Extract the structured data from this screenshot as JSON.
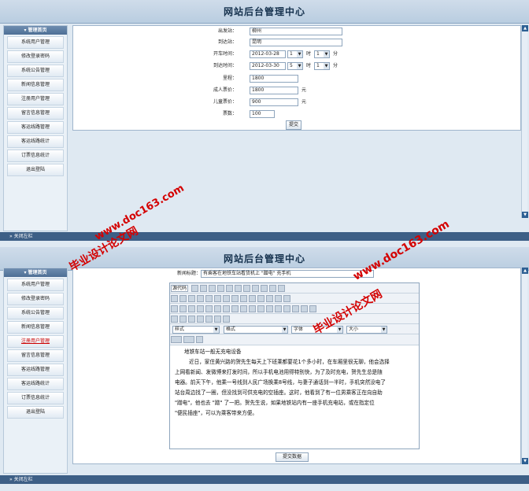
{
  "app_title": "网站后台管理中心",
  "sidebar": {
    "header": "管理首页",
    "items": [
      "系统用户管理",
      "修改登录密码",
      "系统公告管理",
      "新闻信息管理",
      "注册用户管理",
      "留言信息管理",
      "客运线路管理",
      "客运线路统计",
      "订票信息统计",
      "退出登陆"
    ],
    "close_label": "关闭左栏"
  },
  "form1": {
    "depart_label": "出发站：",
    "depart_value": "柳州",
    "arrive_label": "到达站：",
    "arrive_value": "昆明",
    "depart_time_label": "开车时间：",
    "depart_date": "2012-03-28",
    "depart_hour": "1",
    "depart_min": "1",
    "arrive_time_label": "到达时间：",
    "arrive_date": "2012-03-30",
    "arrive_hour": "5",
    "arrive_min": "1",
    "hour_unit": "时",
    "min_unit": "分",
    "distance_label": "里程：",
    "distance_value": "1800",
    "adult_label": "成人票价：",
    "adult_value": "1800",
    "child_label": "儿童票价：",
    "child_value": "900",
    "yuan": "元",
    "tickets_label": "票数：",
    "tickets_value": "100",
    "submit": "提交"
  },
  "form2": {
    "title_label": "新闻标题：",
    "title_value": "有乘客在地铁车站看货机上 \"蹭电\" 充手机",
    "toolbar": {
      "source": "源代码",
      "style": "样式",
      "format": "格式",
      "font": "字体",
      "size": "大小"
    },
    "content": [
      "地铁车站一般无充电设备",
      "近日，家住黄兴路的贺先生每天上下班乘都要花1个多小时，在车厢里很无聊，他会选择",
      "上网看新闻、发微博来打发时间，所以手机电池用得特别快，为了及时充电，贺先生总是随",
      "电器。前天下午，他乘一号线到人民广场换乘8号线，与妻子通话到一半时，手机突然没电了",
      "站台周边找了一圈，但没找到可供充电的空插座。这时，他看到了有一位男乘客正在向自助",
      "\"蹭电\"，他也去 \"蹭\" 了一把。贺先生说，如果地铁站内有一座手机充电站，或在指定位",
      "\"便民插座\"，可以为乘客带来方便。"
    ],
    "submit": "提交数据"
  },
  "watermark": {
    "line1": "www.doc163.com",
    "line2": "毕业设计论文网"
  }
}
